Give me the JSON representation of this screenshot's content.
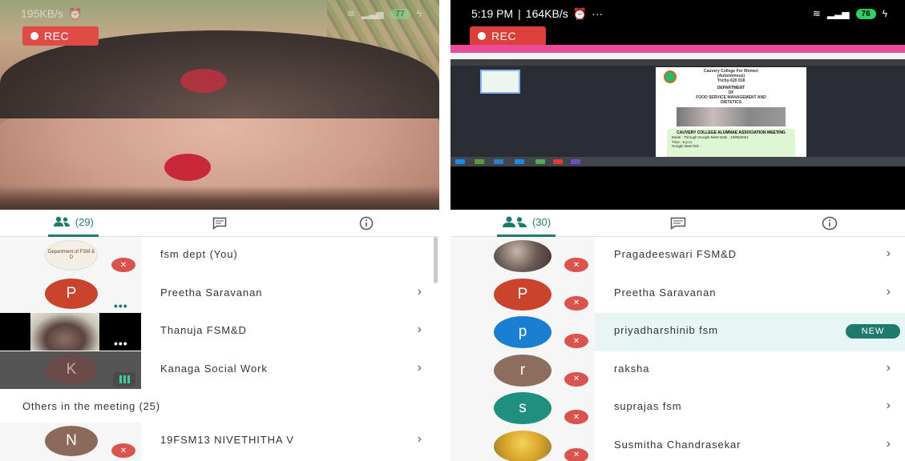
{
  "left": {
    "status": {
      "speed": "195KB/s",
      "battery": "77"
    },
    "rec_label": "REC",
    "tabs": {
      "people_count": "(29)"
    },
    "participants": [
      {
        "name": "fsm dept (You)",
        "avatar_text": "Department of FSM & D"
      },
      {
        "name": "Preetha Saravanan",
        "initial": "P",
        "color": "#c9432d"
      },
      {
        "name": "Thanuja FSM&D"
      },
      {
        "name": "Kanaga Social Work",
        "initial": "K",
        "color": "#6b4a4a"
      }
    ],
    "others_label": "Others in the meeting (25)",
    "others": [
      {
        "name": "19FSM13 NIVETHITHA V",
        "initial": "N",
        "color": "#8b6a5c"
      }
    ]
  },
  "right": {
    "status": {
      "time": "5:19 PM",
      "speed": "164KB/s",
      "dots": "···",
      "battery": "76"
    },
    "rec_label": "REC",
    "shared_doc": {
      "title_lines": [
        "Cauvery College For Women",
        "(Autonomous)",
        "Trichy-620 018"
      ],
      "dept_lines": [
        "DEPARTMENT",
        "OF",
        "FOOD SERVICE MANAGEMENT AND",
        "DIETETICS"
      ],
      "meeting_title": "CAUVERY COLLEGE ALUMNAE ASSOCIATION MEETING",
      "details": [
        "Mode : Through Google Meet Date : 10/05/2021",
        "Time : 5 p.m.",
        "Google Meet link :"
      ]
    },
    "tabs": {
      "people_count": "(30)"
    },
    "participants": [
      {
        "name": "Pragadeeswari FSM&D"
      },
      {
        "name": "Preetha Saravanan",
        "initial": "P",
        "color": "#c9432d"
      },
      {
        "name": "priyadharshinib fsm",
        "initial": "p",
        "color": "#1a7fd1",
        "badge": "NEW"
      },
      {
        "name": "raksha",
        "initial": "r",
        "color": "#8d6d5e"
      },
      {
        "name": "suprajas fsm",
        "initial": "s",
        "color": "#1f8f7f"
      },
      {
        "name": "Susmitha Chandrasekar"
      }
    ]
  },
  "icons": {
    "chevron": "›",
    "people": "people-icon",
    "chat": "chat-icon",
    "info": "info-icon",
    "mic_off": "mic-off-icon"
  }
}
